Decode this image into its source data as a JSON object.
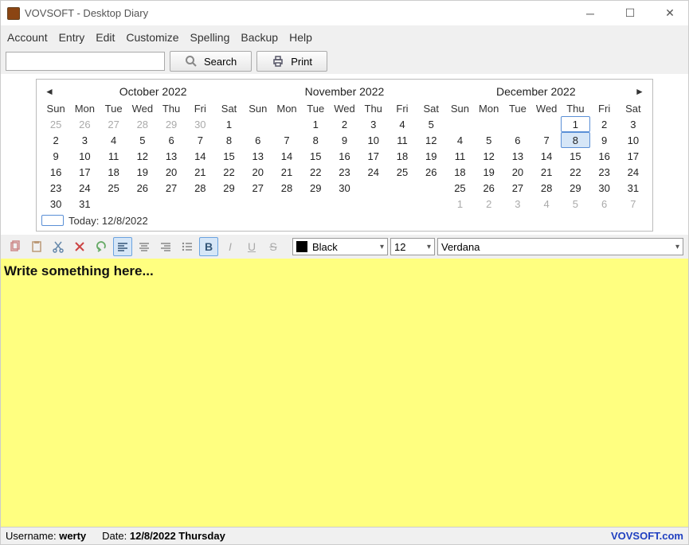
{
  "window": {
    "title": "VOVSOFT - Desktop Diary"
  },
  "menu": {
    "items": [
      "Account",
      "Entry",
      "Edit",
      "Customize",
      "Spelling",
      "Backup",
      "Help"
    ]
  },
  "toolbar": {
    "search_label": "Search",
    "print_label": "Print",
    "search_value": ""
  },
  "calendar": {
    "prev_icon": "◄",
    "next_icon": "►",
    "months": [
      "October 2022",
      "November 2022",
      "December 2022"
    ],
    "day_headers": [
      "Sun",
      "Mon",
      "Tue",
      "Wed",
      "Thu",
      "Fri",
      "Sat"
    ],
    "oct": {
      "lead_other": [
        25,
        26,
        27,
        28,
        29,
        30
      ],
      "days": [
        1,
        2,
        3,
        4,
        5,
        6,
        7,
        8,
        9,
        10,
        11,
        12,
        13,
        14,
        15,
        16,
        17,
        18,
        19,
        20,
        21,
        22,
        23,
        24,
        25,
        26,
        27,
        28,
        29,
        30,
        31
      ]
    },
    "nov": {
      "lead_blank": 2,
      "days": [
        1,
        2,
        3,
        4,
        5,
        6,
        7,
        8,
        9,
        10,
        11,
        12,
        13,
        14,
        15,
        16,
        17,
        18,
        19,
        20,
        21,
        22,
        23,
        24,
        25,
        26,
        27,
        28,
        29,
        30
      ]
    },
    "dec": {
      "lead_blank": 4,
      "days": [
        1,
        2,
        3,
        4,
        5,
        6,
        7,
        8,
        9,
        10,
        11,
        12,
        13,
        14,
        15,
        16,
        17,
        18,
        19,
        20,
        21,
        22,
        23,
        24,
        25,
        26,
        27,
        28,
        29,
        30,
        31
      ],
      "trail_other": [
        1,
        2,
        3,
        4,
        5,
        6,
        7
      ],
      "today": 1,
      "selected": 8
    },
    "today_label": "Today: 12/8/2022"
  },
  "format": {
    "color_label": "Black",
    "size_label": "12",
    "font_label": "Verdana"
  },
  "editor": {
    "placeholder": "Write something here..."
  },
  "status": {
    "user_label": "Username: ",
    "user_value": "werty",
    "date_label": "Date: ",
    "date_value": "12/8/2022 Thursday",
    "brand": "VOVSOFT.com"
  }
}
